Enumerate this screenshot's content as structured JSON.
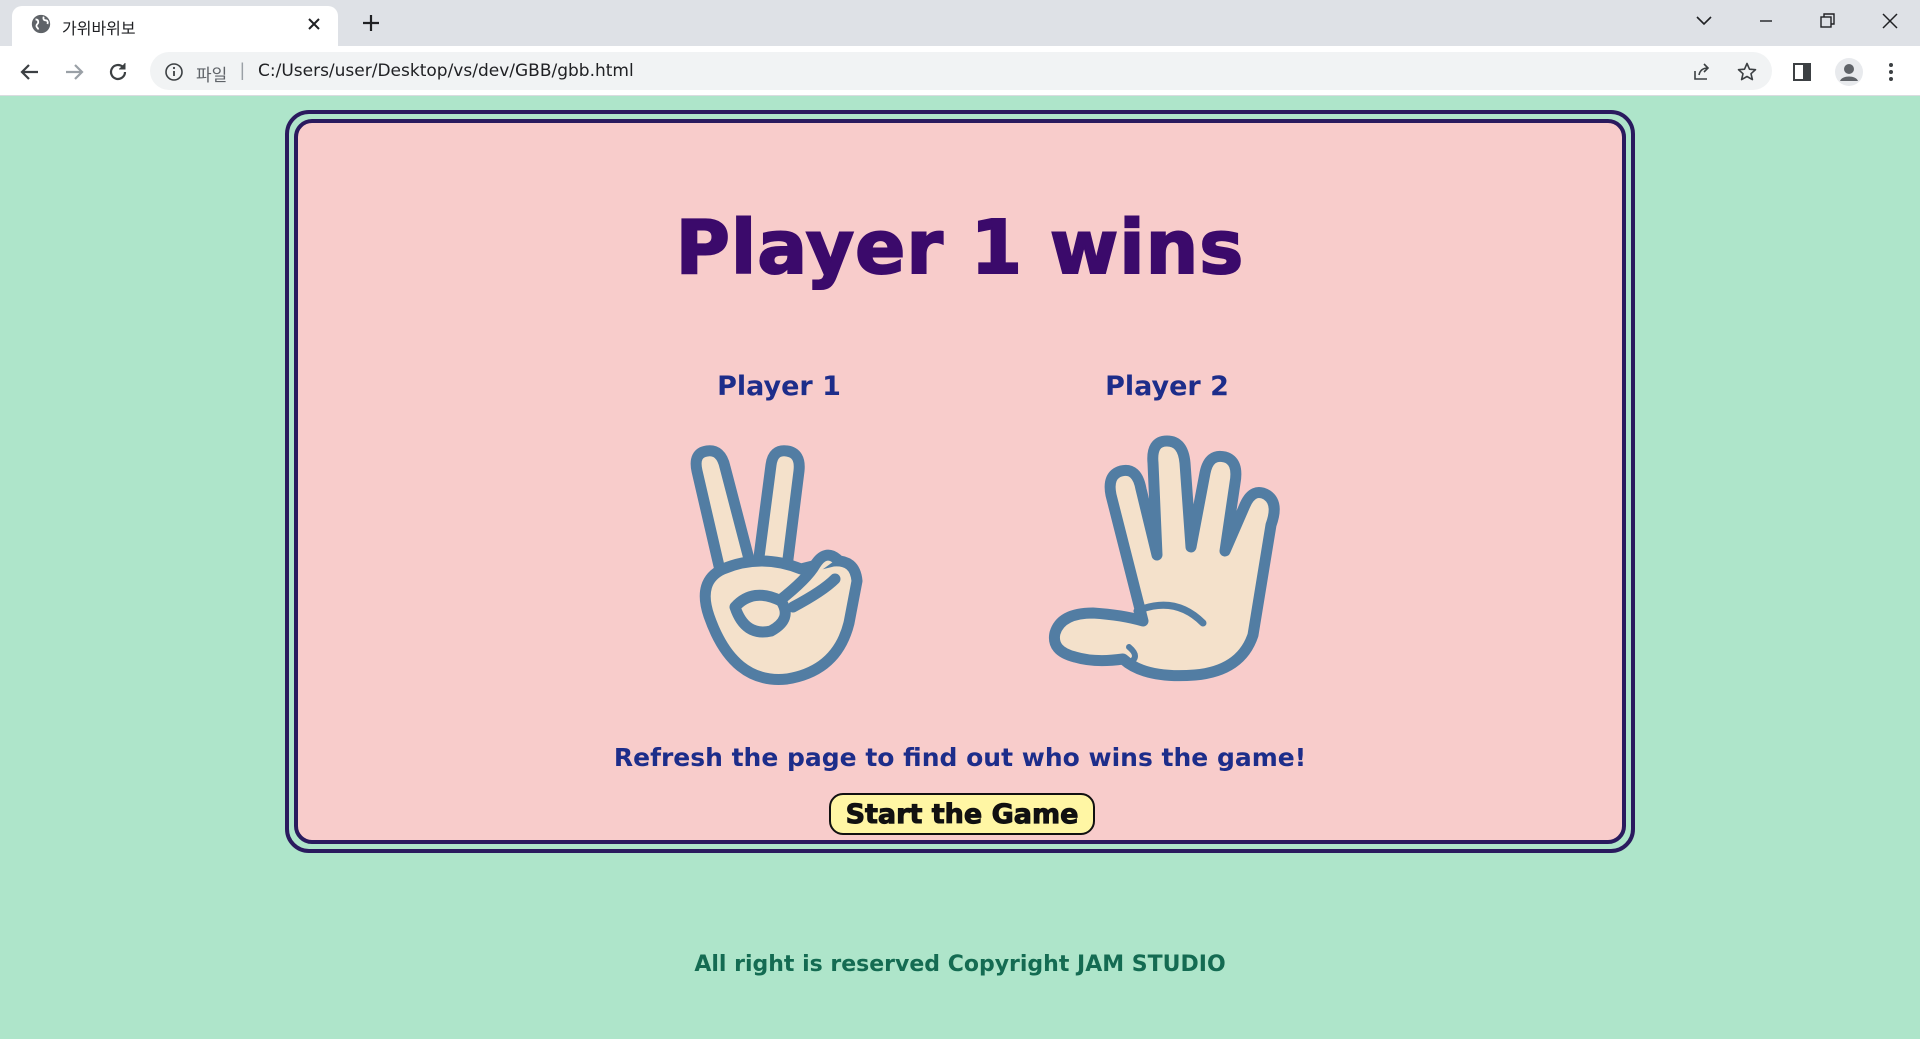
{
  "browser": {
    "tab_title": "가위바위보",
    "scheme_label": "파일",
    "url": "C:/Users/user/Desktop/vs/dev/GBB/gbb.html"
  },
  "game": {
    "result_title": "Player 1 wins",
    "player1": {
      "label": "Player 1",
      "hand": "scissors-hand-icon"
    },
    "player2": {
      "label": "Player 2",
      "hand": "paper-hand-icon"
    },
    "message": "Refresh the page to find out who wins the game!",
    "start_button": "Start the Game"
  },
  "footer": {
    "copyright": "All right is reserved Copyright JAM STUDIO"
  },
  "colors": {
    "page_background": "#aee5ca",
    "card_background": "#f8cccb",
    "border": "#2a1a5e",
    "title": "#3b0a6b",
    "text": "#1d2d8a",
    "button_background": "#fff6a4",
    "footer_text": "#146b52"
  }
}
